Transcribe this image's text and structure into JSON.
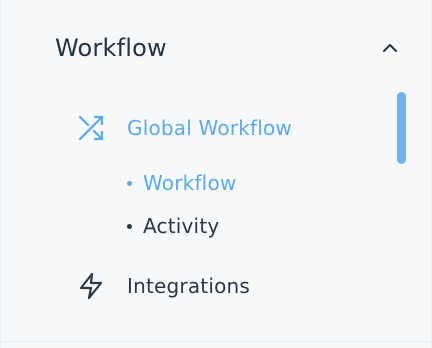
{
  "section": {
    "title": "Workflow",
    "chevron_icon": "chevron-up-icon",
    "expanded": true
  },
  "nav": {
    "global_workflow": {
      "label": "Global Workflow",
      "icon": "shuffle-icon",
      "active": true
    },
    "sub_items": [
      {
        "label": "Workflow",
        "active": true
      },
      {
        "label": "Activity",
        "active": false
      }
    ],
    "integrations": {
      "label": "Integrations",
      "icon": "lightning-icon",
      "active": false
    }
  },
  "colors": {
    "accent": "#5aaaf0",
    "text": "#2b3847",
    "heading": "#243342",
    "background": "#f6f8fa"
  }
}
